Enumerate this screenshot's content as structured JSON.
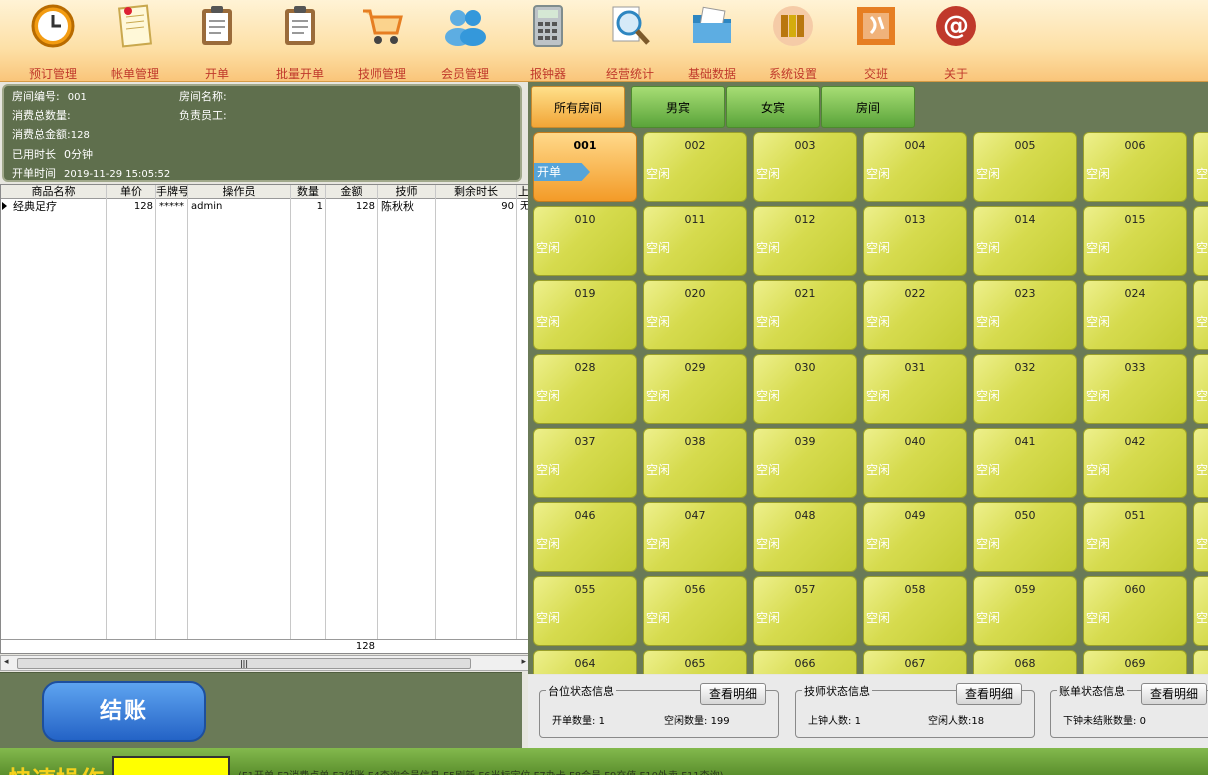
{
  "toolbar": [
    {
      "label": "预订管理",
      "icon": "clock-icon"
    },
    {
      "label": "帐单管理",
      "icon": "bill-icon"
    },
    {
      "label": "开单",
      "icon": "clipboard-icon"
    },
    {
      "label": "批量开单",
      "icon": "clipboard-batch-icon"
    },
    {
      "label": "技师管理",
      "icon": "cart-icon"
    },
    {
      "label": "会员管理",
      "icon": "users-icon"
    },
    {
      "label": "报钟器",
      "icon": "calculator-icon"
    },
    {
      "label": "经营统计",
      "icon": "magnifier-icon"
    },
    {
      "label": "基础数据",
      "icon": "folder-icon"
    },
    {
      "label": "系统设置",
      "icon": "books-icon"
    },
    {
      "label": "交班",
      "icon": "handover-icon"
    },
    {
      "label": "关于",
      "icon": "at-icon"
    }
  ],
  "info": {
    "room_no_label": "房间编号:",
    "room_no": "001",
    "room_name_label": "房间名称:",
    "room_name": "",
    "qty_label": "消费总数量:",
    "qty": "",
    "staff_label": "负责员工:",
    "staff": "",
    "amount_label": "消费总金额:",
    "amount": "128",
    "used_label": "已用时长",
    "used": "0分钟",
    "open_time_label": "开单时间",
    "open_time": "2019-11-29 15:05:52"
  },
  "table": {
    "headers": [
      "商品名称",
      "单价",
      "手牌号",
      "操作员",
      "数量",
      "金额",
      "技师",
      "剩余时长",
      "上"
    ],
    "rows": [
      [
        "经典足疗",
        "128",
        "*****",
        "admin",
        "1",
        "128",
        "陈秋秋",
        "90",
        "无"
      ]
    ],
    "total_amount": "128",
    "scroll_thumb_glyph": "|||"
  },
  "checkout_label": "结账",
  "tabs": [
    {
      "label": "所有房间",
      "active": true
    },
    {
      "label": "男宾",
      "active": false
    },
    {
      "label": "女宾",
      "active": false
    },
    {
      "label": "房间",
      "active": false
    }
  ],
  "rooms": {
    "idle_status": "空闲",
    "open_status": "开单",
    "rows": [
      [
        "001",
        "002",
        "003",
        "004",
        "005",
        "006",
        ""
      ],
      [
        "010",
        "011",
        "012",
        "013",
        "014",
        "015",
        ""
      ],
      [
        "019",
        "020",
        "021",
        "022",
        "023",
        "024",
        ""
      ],
      [
        "028",
        "029",
        "030",
        "031",
        "032",
        "033",
        ""
      ],
      [
        "037",
        "038",
        "039",
        "040",
        "041",
        "042",
        ""
      ],
      [
        "046",
        "047",
        "048",
        "049",
        "050",
        "051",
        ""
      ],
      [
        "055",
        "056",
        "057",
        "058",
        "059",
        "060",
        ""
      ],
      [
        "064",
        "065",
        "066",
        "067",
        "068",
        "069",
        ""
      ]
    ],
    "open_rooms": [
      "001"
    ]
  },
  "status": {
    "table": {
      "title": "台位状态信息",
      "button": "查看明细",
      "open_label": "开单数量:",
      "open": "1",
      "idle_label": "空闲数量:",
      "idle": "199"
    },
    "tech": {
      "title": "技师状态信息",
      "button": "查看明细",
      "busy_label": "上钟人数:",
      "busy": "1",
      "idle_label": "空闲人数:",
      "idle": "18"
    },
    "bill": {
      "title": "账单状态信息",
      "button": "查看明细",
      "unpaid_label": "下钟未结账数量:",
      "unpaid": "0"
    }
  },
  "bottom": {
    "quick_label": "快速操作",
    "shortcuts": "(F1开单 F2消费点单 F3结账 F4查询会员信息 F5刷新 F6当标定位 F7办卡 F8会员 F9充值 F10外卖 F11查询)"
  },
  "colors": {
    "toolbar_label": "#c0392b",
    "room_idle": "#d6db4e",
    "room_open": "#f39b28",
    "panel_bg": "#6a7a57"
  }
}
